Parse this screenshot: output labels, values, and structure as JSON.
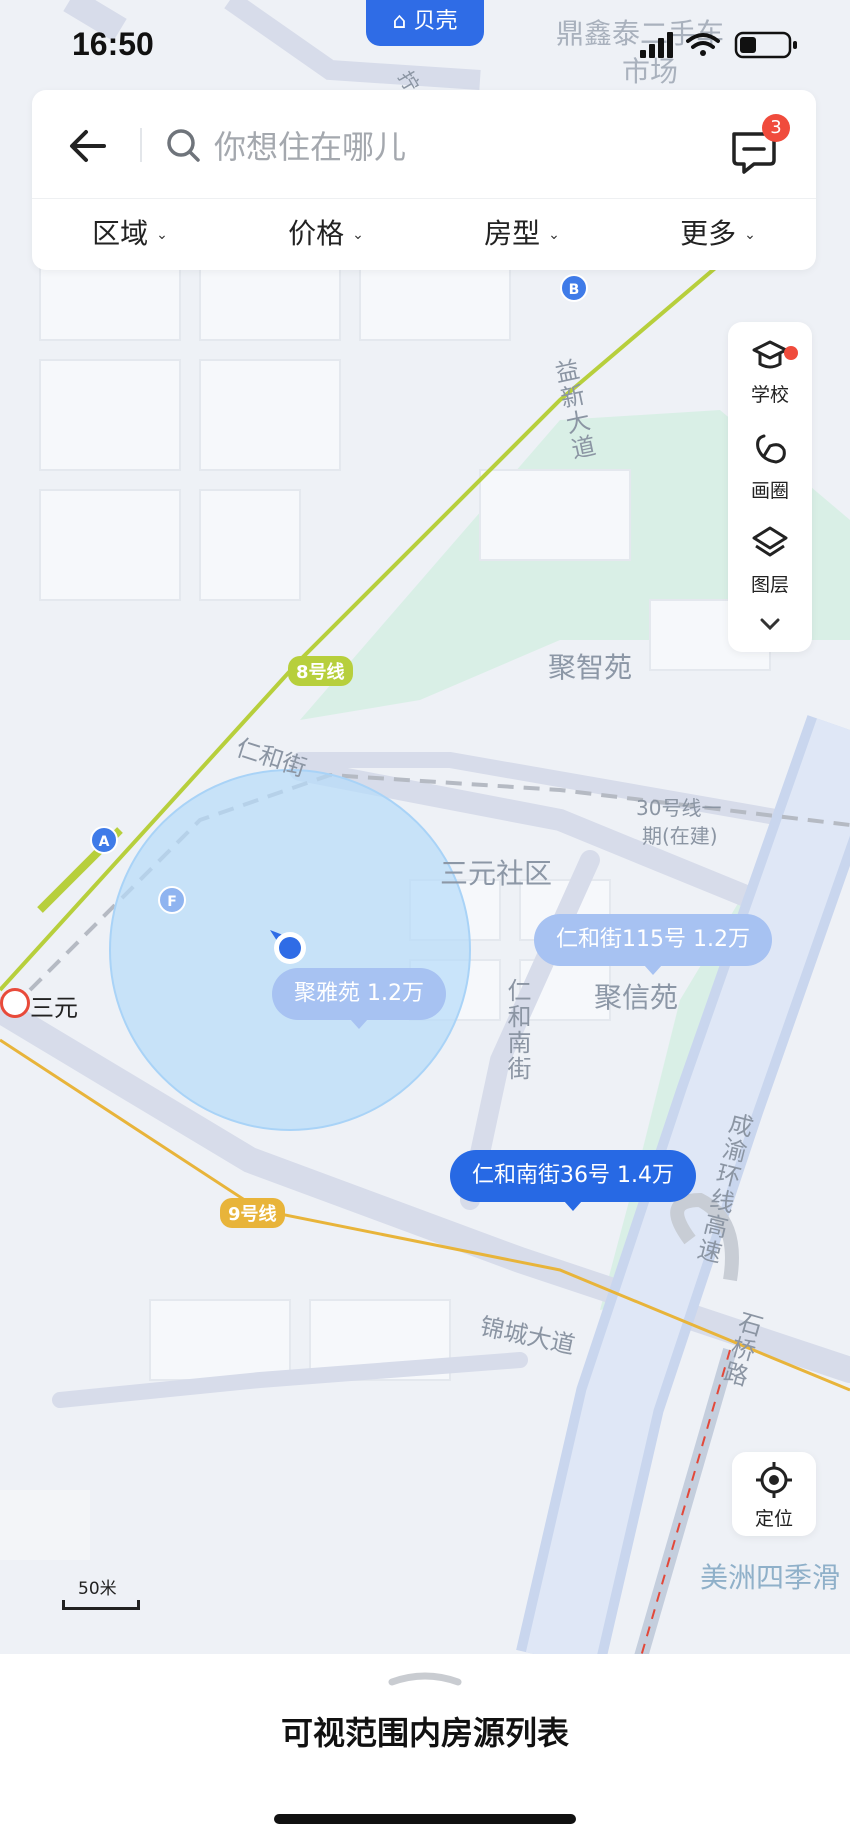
{
  "status_bar": {
    "time": "16:50",
    "brand": "贝壳"
  },
  "search": {
    "placeholder": "你想住在哪儿",
    "message_count": "3"
  },
  "filters": [
    {
      "label": "区域"
    },
    {
      "label": "价格"
    },
    {
      "label": "房型"
    },
    {
      "label": "更多"
    }
  ],
  "tools": {
    "school": "学校",
    "draw": "画圈",
    "layers": "图层",
    "locate": "定位"
  },
  "map": {
    "top_label_1": "鼎鑫泰二手车",
    "top_label_2": "市场",
    "road_1": "益新大道",
    "road_2": "仁和街",
    "road_3": "仁和南街",
    "road_4": "锦城大道",
    "road_5": "成渝环线高速",
    "road_6": "石桥路",
    "metro_line_8": "8号线",
    "metro_line_9": "9号线",
    "metro_line_30_a": "30号线一",
    "metro_line_30_b": "期(在建)",
    "community_1": "聚智苑",
    "community_2": "三元社区",
    "community_3": "聚信苑",
    "station": "三元",
    "poi_bottom_right": "美洲四季滑",
    "poi_marker_a": "A",
    "poi_marker_b": "B",
    "poi_marker_f": "F",
    "scale_label": "50米",
    "road_top_char": "拧"
  },
  "listings": [
    {
      "label": "聚雅苑 1.2万",
      "style": "light"
    },
    {
      "label": "仁和街115号 1.2万",
      "style": "light"
    },
    {
      "label": "仁和南街36号 1.4万",
      "style": "dark"
    }
  ],
  "bottom_sheet": {
    "title": "可视范围内房源列表"
  },
  "colors": {
    "accent": "#2769e4",
    "badge_red": "#f04b3c",
    "metro_8": "#b7cf3c",
    "metro_9": "#e8b43a"
  }
}
